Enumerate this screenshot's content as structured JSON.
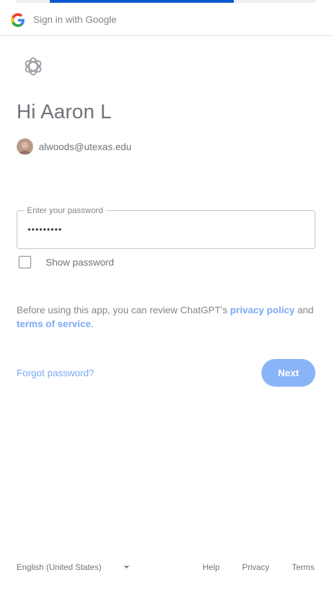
{
  "header": {
    "title": "Sign in with Google"
  },
  "progress": {
    "fraction": 0.62
  },
  "icons": {
    "google": "google-g-logo",
    "app": "openai-logo",
    "avatar": "user-avatar-photo",
    "dropdown": "caret-down"
  },
  "greeting": "Hi Aaron L",
  "account": {
    "email": "alwoods@utexas.edu"
  },
  "password": {
    "label": "Enter your password",
    "value": "•••••••••"
  },
  "show_password": {
    "label": "Show password",
    "checked": false
  },
  "notice": {
    "prefix": "Before using this app, you can review ChatGPT’s ",
    "privacy_link": "privacy policy",
    "middle": " and ",
    "terms_link": "terms of service",
    "suffix": "."
  },
  "actions": {
    "forgot": "Forgot password?",
    "next": "Next"
  },
  "footer": {
    "language": "English (United States)",
    "help": "Help",
    "privacy": "Privacy",
    "terms": "Terms"
  },
  "colors": {
    "accent": "#0b57d0",
    "button": "#8ab4f8",
    "link": "#7baaf7"
  }
}
